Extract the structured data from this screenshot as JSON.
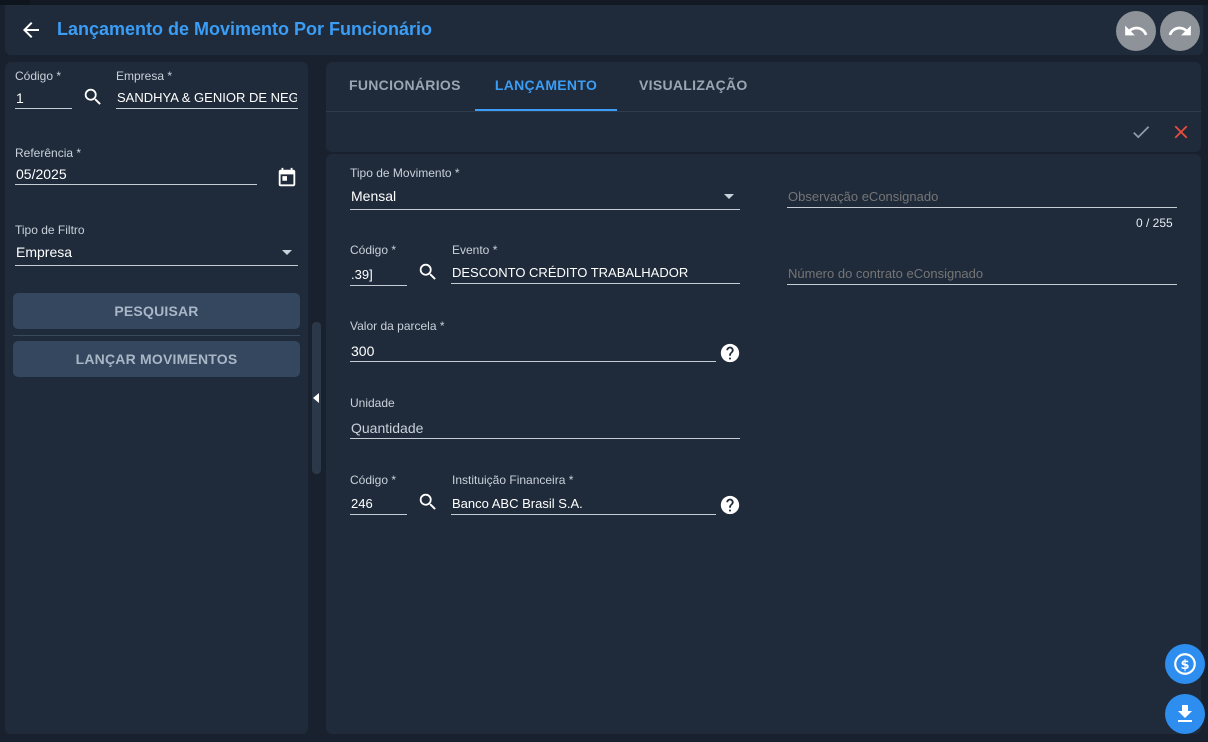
{
  "header": {
    "title": "Lançamento de Movimento Por Funcionário",
    "back_icon": "arrow-left-icon",
    "undo_icon": "undo-icon",
    "redo_icon": "redo-icon"
  },
  "left_panel": {
    "codigo": {
      "label": "Código *",
      "value": "1"
    },
    "empresa": {
      "label": "Empresa *",
      "value": "SANDHYA & GENIOR DE NEGO"
    },
    "referencia": {
      "label": "Referência *",
      "value": "05/2025"
    },
    "tipo_filtro": {
      "label": "Tipo de Filtro",
      "value": "Empresa"
    },
    "pesquisar_label": "PESQUISAR",
    "lancar_label": "LANÇAR MOVIMENTOS"
  },
  "tabs": [
    {
      "label": "FUNCIONÁRIOS"
    },
    {
      "label": "LANÇAMENTO"
    },
    {
      "label": "VISUALIZAÇÃO"
    }
  ],
  "form": {
    "tipo_movimento": {
      "label": "Tipo de Movimento *",
      "value": "Mensal"
    },
    "observacao": {
      "placeholder": "Observação eConsignado",
      "counter": "0 / 255"
    },
    "evento_codigo": {
      "label": "Código *",
      "value": ".39]"
    },
    "evento": {
      "label": "Evento *",
      "value": "DESCONTO CRÉDITO TRABALHADOR"
    },
    "numero_contrato": {
      "placeholder": "Número do contrato eConsignado"
    },
    "valor_parcela": {
      "label": "Valor da parcela *",
      "value": "300"
    },
    "unidade": {
      "label": "Unidade",
      "value": "Quantidade"
    },
    "instituicao_codigo": {
      "label": "Código *",
      "value": "246"
    },
    "instituicao": {
      "label": "Instituição Financeira *",
      "value": "Banco ABC Brasil S.A."
    }
  },
  "colors": {
    "accent": "#3b9df5",
    "background": "#18212d",
    "panel": "#1f2b3a",
    "button": "#34475e",
    "cancel": "#e74c3c"
  }
}
